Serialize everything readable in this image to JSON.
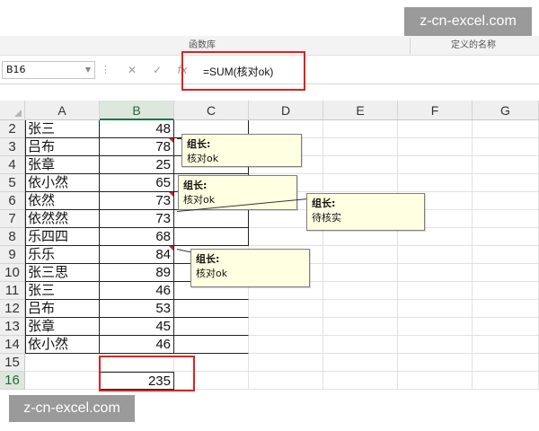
{
  "ribbon": {
    "group_left": "函数库",
    "group_right": "定义的名称"
  },
  "formula_bar": {
    "name_box": "B16",
    "cancel_icon": "✕",
    "enter_icon": "✓",
    "fx_label": "fx",
    "formula": "=SUM(核对ok)"
  },
  "columns": [
    "A",
    "B",
    "C",
    "D",
    "E",
    "F",
    "G"
  ],
  "selected_column": "B",
  "rows": [
    {
      "num": "2",
      "name": "张三",
      "value": "48"
    },
    {
      "num": "3",
      "name": "吕布",
      "value": "78"
    },
    {
      "num": "4",
      "name": "张章",
      "value": "25"
    },
    {
      "num": "5",
      "name": "依小然",
      "value": "65"
    },
    {
      "num": "6",
      "name": "依然",
      "value": "73"
    },
    {
      "num": "7",
      "name": "依然然",
      "value": "73"
    },
    {
      "num": "8",
      "name": "乐四四",
      "value": "68"
    },
    {
      "num": "9",
      "name": "乐乐",
      "value": "84"
    },
    {
      "num": "10",
      "name": "张三思",
      "value": "89"
    },
    {
      "num": "11",
      "name": "张三",
      "value": "46"
    },
    {
      "num": "12",
      "name": "吕布",
      "value": "53"
    },
    {
      "num": "13",
      "name": "张章",
      "value": "45"
    },
    {
      "num": "14",
      "name": "依小然",
      "value": "46"
    },
    {
      "num": "15",
      "name": "",
      "value": ""
    },
    {
      "num": "16",
      "name": "",
      "value": "235"
    }
  ],
  "selected_row": "16",
  "comments": [
    {
      "author": "组长:",
      "text": "核对ok"
    },
    {
      "author": "组长:",
      "text": "核对ok"
    },
    {
      "author": "组长:",
      "text": "待核实"
    },
    {
      "author": "组长:",
      "text": "核对ok"
    }
  ],
  "watermarks": {
    "top": "z-cn-excel.com",
    "bottom": "z-cn-excel.com"
  },
  "colors": {
    "highlight_red": "#e02020",
    "comment_bg": "#ffffe1",
    "excel_green": "#217346"
  }
}
